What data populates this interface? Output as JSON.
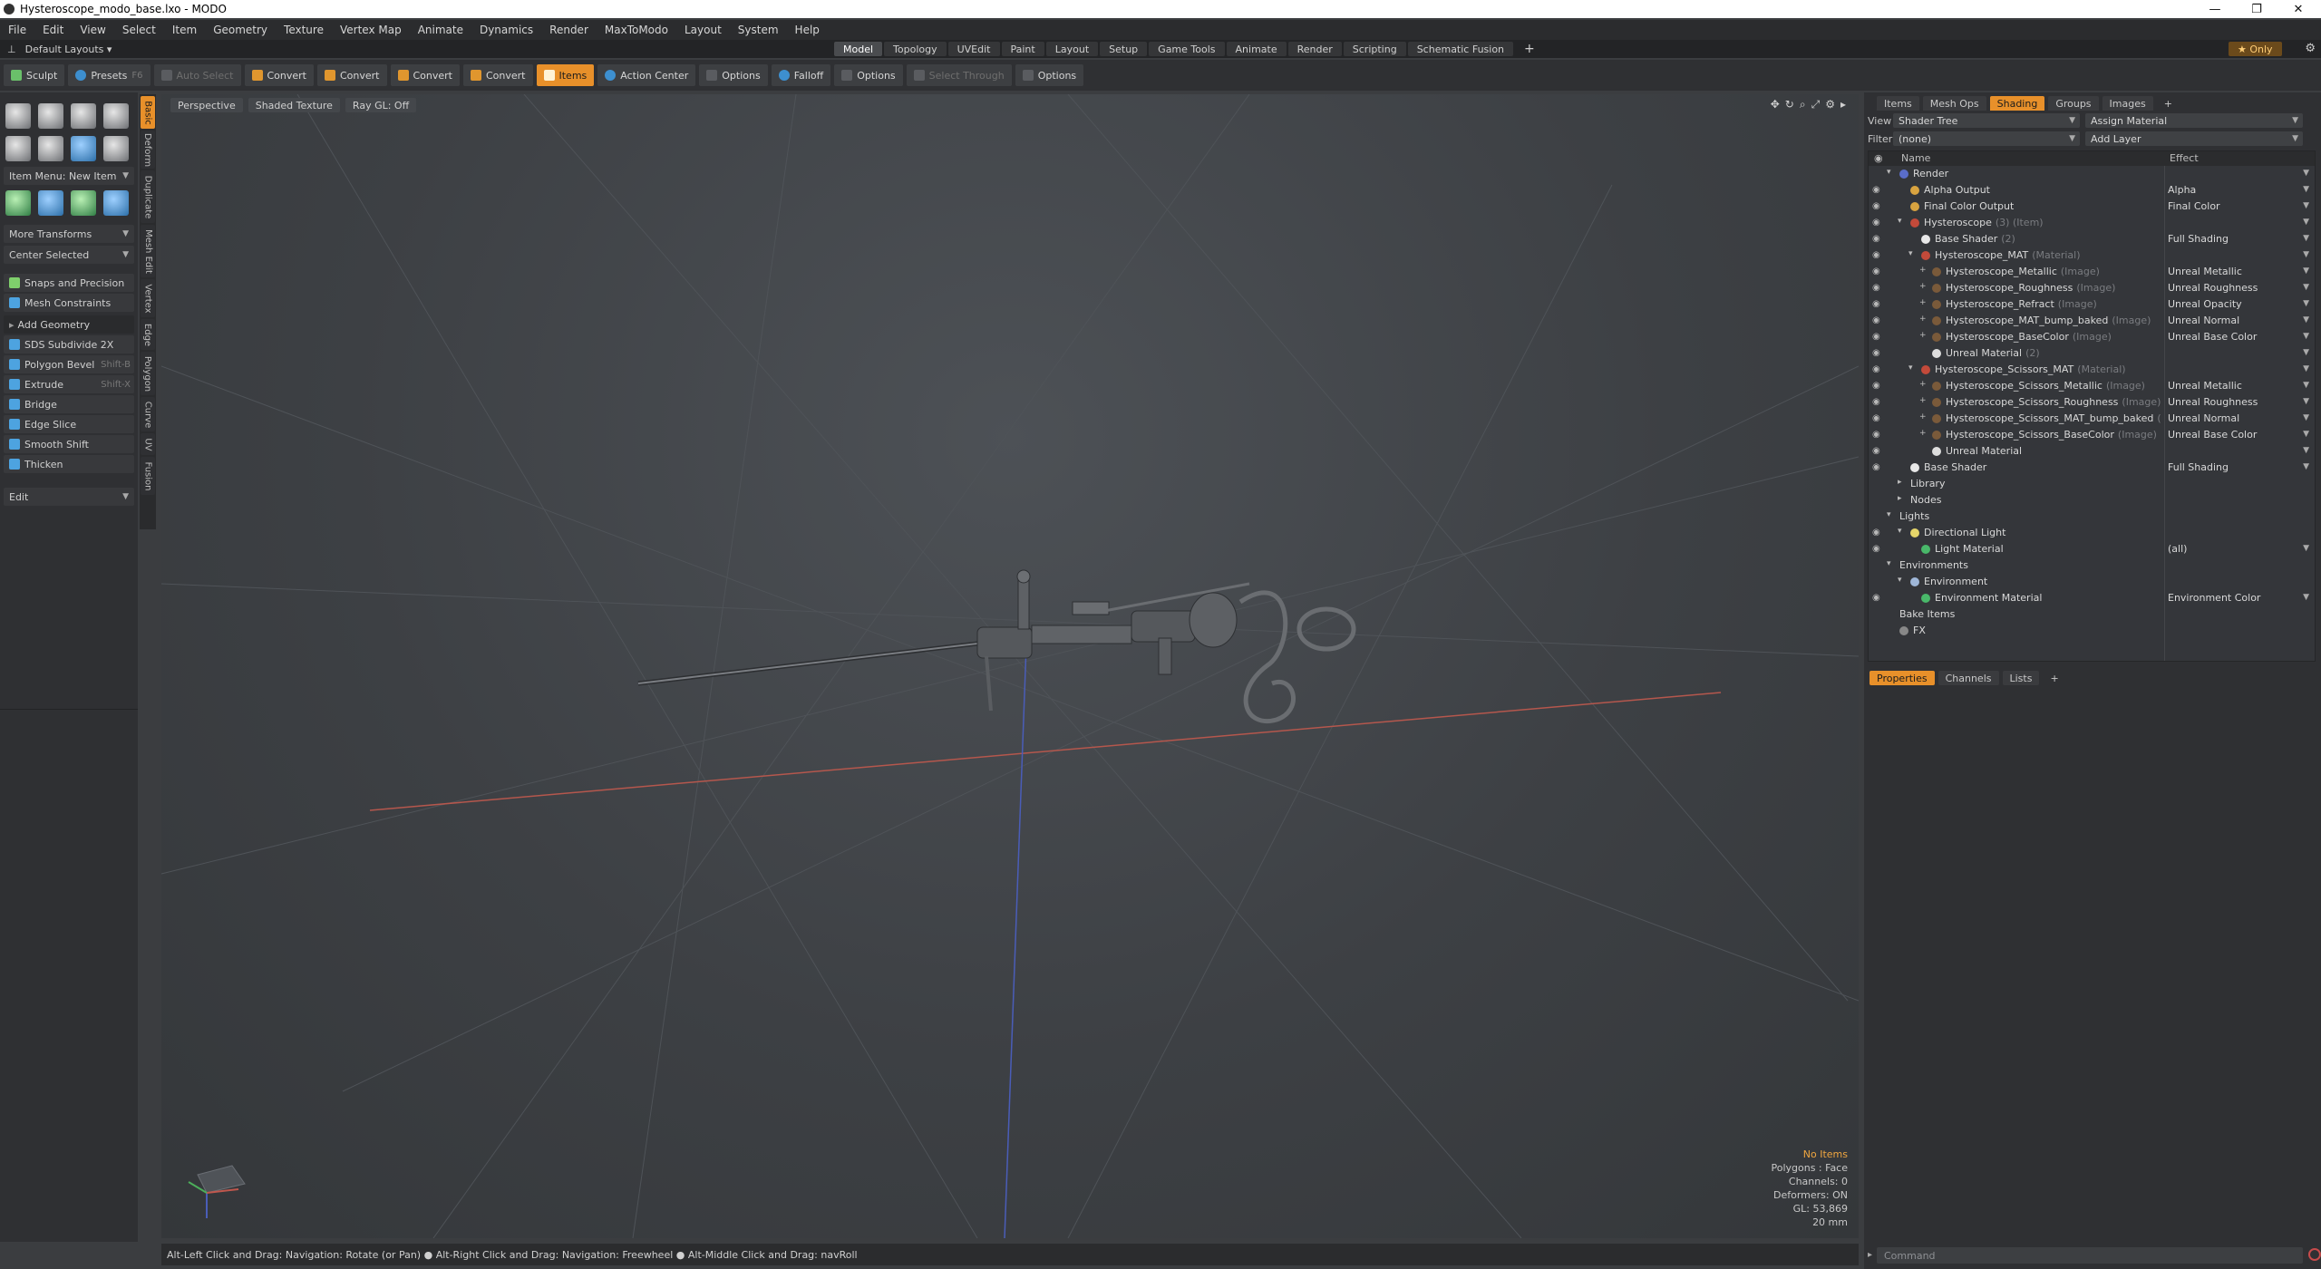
{
  "window": {
    "title": "Hysteroscope_modo_base.lxo - MODO"
  },
  "menu": [
    "File",
    "Edit",
    "View",
    "Select",
    "Item",
    "Geometry",
    "Texture",
    "Vertex Map",
    "Animate",
    "Dynamics",
    "Render",
    "MaxToModo",
    "Layout",
    "System",
    "Help"
  ],
  "layout": {
    "label": "Default Layouts",
    "tabs": [
      "Model",
      "Topology",
      "UVEdit",
      "Paint",
      "Layout",
      "Setup",
      "Game Tools",
      "Animate",
      "Render",
      "Scripting",
      "Schematic Fusion"
    ],
    "only": "Only"
  },
  "toolbar": {
    "sculpt": "Sculpt",
    "presets": "Presets",
    "presets_key": "F6",
    "auto_select": "Auto Select",
    "convert": "Convert",
    "items": "Items",
    "action_center": "Action Center",
    "options": "Options",
    "falloff": "Falloff",
    "select_through": "Select Through"
  },
  "left_panel": {
    "item_menu": "Item Menu: New Item",
    "more_transforms": "More Transforms",
    "center_selected": "Center Selected",
    "snaps": "Snaps and Precision",
    "constraints": "Mesh Constraints",
    "add_geometry": "Add Geometry",
    "tools": [
      {
        "label": "SDS Subdivide 2X",
        "key": ""
      },
      {
        "label": "Polygon Bevel",
        "key": "Shift-B"
      },
      {
        "label": "Extrude",
        "key": "Shift-X"
      },
      {
        "label": "Bridge",
        "key": ""
      },
      {
        "label": "Edge Slice",
        "key": ""
      },
      {
        "label": "Smooth Shift",
        "key": ""
      },
      {
        "label": "Thicken",
        "key": ""
      }
    ],
    "edit": "Edit"
  },
  "vertical_tabs": [
    "Basic",
    "Deform",
    "Duplicate",
    "Mesh Edit",
    "Vertex",
    "Edge",
    "Polygon",
    "Curve",
    "UV",
    "Fusion"
  ],
  "viewport": {
    "tabs": [
      "Perspective",
      "Shaded Texture",
      "Ray GL: Off"
    ],
    "stats": {
      "items": "No Items",
      "polygons": "Polygons : Face",
      "channels": "Channels: 0",
      "deformers": "Deformers: ON",
      "gl": "GL: 53,869",
      "scale": "20 mm"
    }
  },
  "status": "Alt-Left Click and Drag: Navigation: Rotate (or Pan) ●  Alt-Right Click and Drag: Navigation: Freewheel ●  Alt-Middle Click and Drag: navRoll",
  "right_panel": {
    "tabs": [
      "Items",
      "Mesh Ops",
      "Shading",
      "Groups",
      "Images"
    ],
    "view_label": "View",
    "view_value": "Shader Tree",
    "assign": "Assign Material",
    "filter_label": "Filter",
    "filter_value": "(none)",
    "add_layer": "Add Layer",
    "col_name": "Name",
    "col_effect": "Effect",
    "tree": [
      {
        "name": "Render",
        "sub": "",
        "effect": "",
        "indent": 0,
        "eye": false,
        "tri": "▾",
        "color": "#5a6dc9"
      },
      {
        "name": "Alpha Output",
        "sub": "",
        "effect": "Alpha",
        "indent": 1,
        "eye": true,
        "tri": "",
        "color": "#d9a440"
      },
      {
        "name": "Final Color Output",
        "sub": "",
        "effect": "Final Color",
        "indent": 1,
        "eye": true,
        "tri": "",
        "color": "#d9a440"
      },
      {
        "name": "Hysteroscope",
        "sub": "(3) (Item)",
        "effect": "",
        "indent": 1,
        "eye": true,
        "tri": "▾",
        "color": "#c34a3a"
      },
      {
        "name": "Base Shader",
        "sub": "(2)",
        "effect": "Full Shading",
        "indent": 2,
        "eye": true,
        "tri": "",
        "color": "#e8e8e8"
      },
      {
        "name": "Hysteroscope_MAT",
        "sub": "(Material)",
        "effect": "",
        "indent": 2,
        "eye": true,
        "tri": "▾",
        "color": "#c34a3a"
      },
      {
        "name": "Hysteroscope_Metallic",
        "sub": "(Image)",
        "effect": "Unreal Metallic",
        "indent": 3,
        "eye": true,
        "tri": "+",
        "color": "#7a5a3a"
      },
      {
        "name": "Hysteroscope_Roughness",
        "sub": "(Image)",
        "effect": "Unreal Roughness",
        "indent": 3,
        "eye": true,
        "tri": "+",
        "color": "#7a5a3a"
      },
      {
        "name": "Hysteroscope_Refract",
        "sub": "(Image)",
        "effect": "Unreal Opacity",
        "indent": 3,
        "eye": true,
        "tri": "+",
        "color": "#7a5a3a"
      },
      {
        "name": "Hysteroscope_MAT_bump_baked",
        "sub": "(Image)",
        "effect": "Unreal Normal",
        "indent": 3,
        "eye": true,
        "tri": "+",
        "color": "#7a5a3a"
      },
      {
        "name": "Hysteroscope_BaseColor",
        "sub": "(Image)",
        "effect": "Unreal Base Color",
        "indent": 3,
        "eye": true,
        "tri": "+",
        "color": "#7a5a3a"
      },
      {
        "name": "Unreal Material",
        "sub": "(2)",
        "effect": "",
        "indent": 3,
        "eye": true,
        "tri": "",
        "color": "#dddddd"
      },
      {
        "name": "Hysteroscope_Scissors_MAT",
        "sub": "(Material)",
        "effect": "",
        "indent": 2,
        "eye": true,
        "tri": "▾",
        "color": "#c34a3a"
      },
      {
        "name": "Hysteroscope_Scissors_Metallic",
        "sub": "(Image)",
        "effect": "Unreal Metallic",
        "indent": 3,
        "eye": true,
        "tri": "+",
        "color": "#7a5a3a"
      },
      {
        "name": "Hysteroscope_Scissors_Roughness",
        "sub": "(Image)",
        "effect": "Unreal Roughness",
        "indent": 3,
        "eye": true,
        "tri": "+",
        "color": "#7a5a3a"
      },
      {
        "name": "Hysteroscope_Scissors_MAT_bump_baked",
        "sub": "(",
        "effect": "Unreal Normal",
        "indent": 3,
        "eye": true,
        "tri": "+",
        "color": "#7a5a3a"
      },
      {
        "name": "Hysteroscope_Scissors_BaseColor",
        "sub": "(Image)",
        "effect": "Unreal Base Color",
        "indent": 3,
        "eye": true,
        "tri": "+",
        "color": "#7a5a3a"
      },
      {
        "name": "Unreal Material",
        "sub": "",
        "effect": "",
        "indent": 3,
        "eye": true,
        "tri": "",
        "color": "#dddddd"
      },
      {
        "name": "Base Shader",
        "sub": "",
        "effect": "Full Shading",
        "indent": 1,
        "eye": true,
        "tri": "",
        "color": "#e8e8e8"
      },
      {
        "name": "Library",
        "sub": "",
        "effect": "",
        "indent": 1,
        "eye": false,
        "tri": "▸",
        "color": ""
      },
      {
        "name": "Nodes",
        "sub": "",
        "effect": "",
        "indent": 1,
        "eye": false,
        "tri": "▸",
        "color": ""
      },
      {
        "name": "Lights",
        "sub": "",
        "effect": "",
        "indent": 0,
        "eye": false,
        "tri": "▾",
        "color": ""
      },
      {
        "name": "Directional Light",
        "sub": "",
        "effect": "",
        "indent": 1,
        "eye": true,
        "tri": "▾",
        "color": "#e6d66a"
      },
      {
        "name": "Light Material",
        "sub": "",
        "effect": "(all)",
        "indent": 2,
        "eye": true,
        "tri": "",
        "color": "#49b86a"
      },
      {
        "name": "Environments",
        "sub": "",
        "effect": "",
        "indent": 0,
        "eye": false,
        "tri": "▾",
        "color": ""
      },
      {
        "name": "Environment",
        "sub": "",
        "effect": "",
        "indent": 1,
        "eye": false,
        "tri": "▾",
        "color": "#9fb7d8"
      },
      {
        "name": "Environment Material",
        "sub": "",
        "effect": "Environment Color",
        "indent": 2,
        "eye": true,
        "tri": "",
        "color": "#49b86a"
      },
      {
        "name": "Bake Items",
        "sub": "",
        "effect": "",
        "indent": 0,
        "eye": false,
        "tri": "",
        "color": ""
      },
      {
        "name": "FX",
        "sub": "",
        "effect": "",
        "indent": 0,
        "eye": false,
        "tri": "",
        "color": "#888888"
      }
    ],
    "props_tabs": [
      "Properties",
      "Channels",
      "Lists"
    ],
    "command_placeholder": "Command"
  }
}
